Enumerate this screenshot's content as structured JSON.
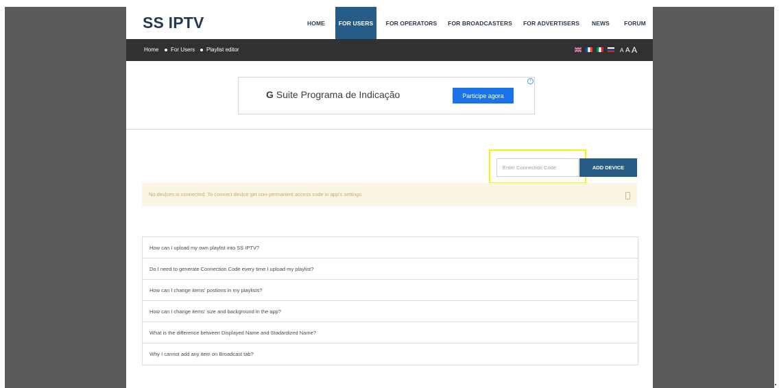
{
  "header": {
    "logo": "SS IPTV",
    "nav": [
      {
        "label": "HOME",
        "active": false
      },
      {
        "label": "FOR USERS",
        "active": true
      },
      {
        "label": "FOR OPERATORS",
        "active": false
      },
      {
        "label": "FOR BROADCASTERS",
        "active": false
      },
      {
        "label": "FOR ADVERTISERS",
        "active": false
      },
      {
        "label": "NEWS",
        "active": false
      },
      {
        "label": "FORUM",
        "active": false
      }
    ]
  },
  "breadcrumb": [
    "Home",
    "For Users",
    "Playlist editor"
  ],
  "languages": [
    "uk-flag-icon",
    "fr-flag-icon",
    "it-flag-icon",
    "ru-flag-icon"
  ],
  "font_size_controls": [
    "A",
    "A",
    "A"
  ],
  "ad": {
    "brand": "G",
    "text": "Suite Programa de Indicação",
    "button": "Participe agora"
  },
  "device": {
    "placeholder": "Enter Connection Code",
    "button": "ADD DEVICE"
  },
  "notice": "No devices is connected. To connect device get non-permanent access code in app's settings",
  "faq": [
    "How can I upload my own playlist into SS IPTV?",
    "Do I need to generate Connection Code every time I upload my playlist?",
    "How can I change items' postions in my playlists?",
    "How can I change items' size and background in the app?",
    "What is the difference between Displayed Name and Stadardized Name?",
    "Why I cannot add any item on Broadcast tab?"
  ],
  "colors": {
    "accent": "#275c86",
    "subbar": "#313131",
    "side": "#5b5b5b",
    "notice_bg": "#fbf6e4",
    "notice_text": "#c8a969",
    "highlight": "#f5f500",
    "ad_button": "#1a73e8"
  }
}
